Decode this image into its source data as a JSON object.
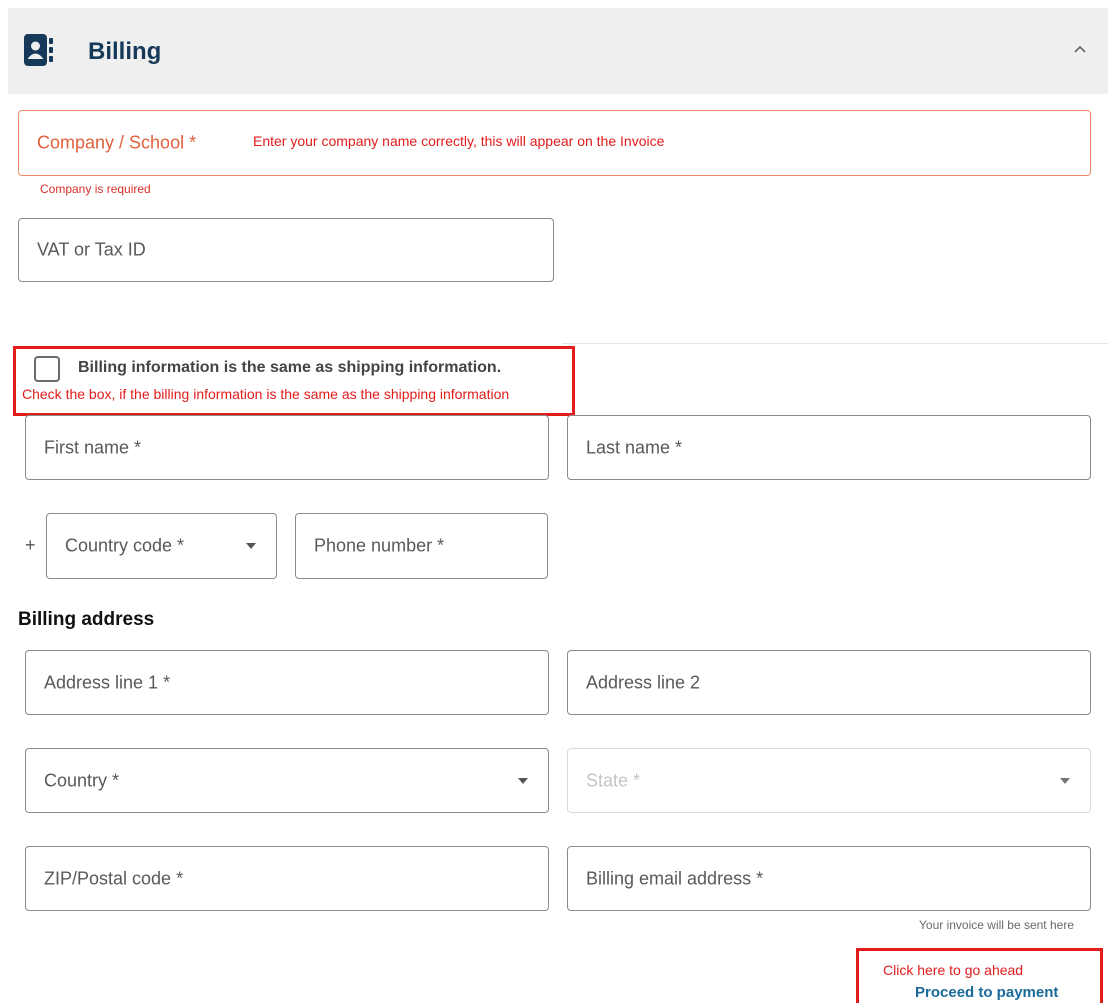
{
  "header": {
    "title": "Billing",
    "icon": "contact-book-icon",
    "collapse_icon": "chevron-up-icon"
  },
  "company": {
    "placeholder": "Company / School *",
    "annotation": "Enter your company name correctly, this will appear on the Invoice",
    "error": "Company is required"
  },
  "vat": {
    "placeholder": "VAT or Tax ID"
  },
  "same_as_shipping": {
    "label": "Billing information is the same as shipping information.",
    "checked": false,
    "annotation": "Check the box, if the billing information is the same as the shipping information"
  },
  "name": {
    "first_placeholder": "First name *",
    "last_placeholder": "Last name *"
  },
  "phone": {
    "plus": "+",
    "country_code_placeholder": "Country code  *",
    "number_placeholder": "Phone number *"
  },
  "billing_address": {
    "title": "Billing address",
    "line1_placeholder": "Address line 1 *",
    "line2_placeholder": "Address line 2",
    "country_placeholder": "Country  *",
    "state_placeholder": "State  *",
    "zip_placeholder": "ZIP/Postal code *",
    "email_placeholder": "Billing email address *",
    "email_hint": "Your invoice will be sent here"
  },
  "proceed": {
    "annotation": "Click here to go ahead",
    "label": "Proceed to payment"
  },
  "colors": {
    "accent": "#16395a",
    "annotation": "#e21b1b",
    "error": "#e0603c",
    "link": "#1a6a9a"
  }
}
